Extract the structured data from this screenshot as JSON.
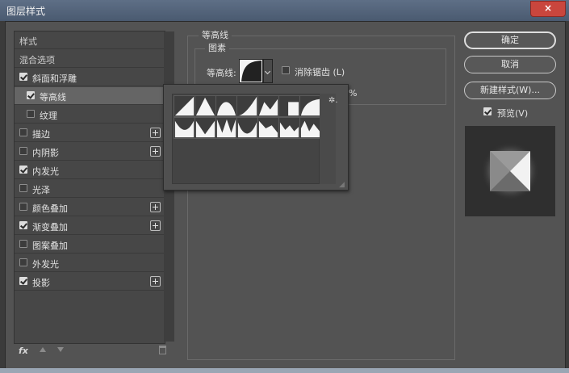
{
  "window": {
    "title": "图层样式",
    "close_glyph": "×"
  },
  "left_panel": {
    "header": "样式",
    "blending_options": "混合选项",
    "items": [
      {
        "label": "斜面和浮雕",
        "checked": true,
        "has_plus": false,
        "indent": false,
        "selected": false
      },
      {
        "label": "等高线",
        "checked": true,
        "has_plus": false,
        "indent": true,
        "selected": true
      },
      {
        "label": "纹理",
        "checked": false,
        "has_plus": false,
        "indent": true,
        "selected": false
      },
      {
        "label": "描边",
        "checked": false,
        "has_plus": true,
        "indent": false,
        "selected": false
      },
      {
        "label": "内阴影",
        "checked": false,
        "has_plus": true,
        "indent": false,
        "selected": false
      },
      {
        "label": "内发光",
        "checked": true,
        "has_plus": false,
        "indent": false,
        "selected": false
      },
      {
        "label": "光泽",
        "checked": false,
        "has_plus": false,
        "indent": false,
        "selected": false
      },
      {
        "label": "颜色叠加",
        "checked": false,
        "has_plus": true,
        "indent": false,
        "selected": false
      },
      {
        "label": "渐变叠加",
        "checked": true,
        "has_plus": true,
        "indent": false,
        "selected": false
      },
      {
        "label": "图案叠加",
        "checked": false,
        "has_plus": false,
        "indent": false,
        "selected": false
      },
      {
        "label": "外发光",
        "checked": false,
        "has_plus": false,
        "indent": false,
        "selected": false
      },
      {
        "label": "投影",
        "checked": true,
        "has_plus": true,
        "indent": false,
        "selected": false
      }
    ],
    "footer": {
      "fx_label": "fx"
    }
  },
  "contour_section": {
    "group_title": "等高线",
    "subgroup_title": "图素",
    "contour_label": "等高线:",
    "anti_alias_label": "消除锯齿 (L)",
    "anti_alias_checked": false,
    "range_unit": "%"
  },
  "contour_picker": {
    "gear_glyph": "✲."
  },
  "right_panel": {
    "ok_button": "确定",
    "cancel_button": "取消",
    "new_style_button": "新建样式(W)...",
    "preview_label": "预览(V)",
    "preview_checked": true
  }
}
